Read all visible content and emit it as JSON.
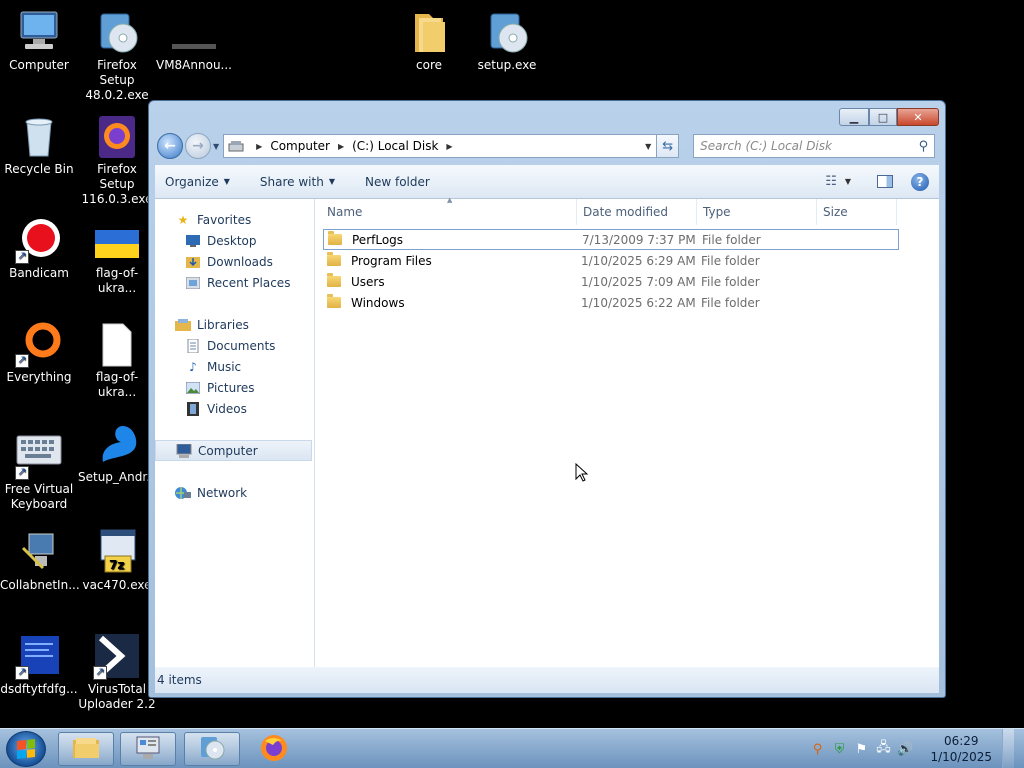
{
  "desktop": {
    "icons": {
      "computer": "Computer",
      "firefox48": "Firefox Setup 48.0.2.exe",
      "vm8": "VM8Annou...",
      "core": "core",
      "setup": "setup.exe",
      "recycle": "Recycle Bin",
      "firefox116": "Firefox Setup 116.0.3.exe",
      "bandicam": "Bandicam",
      "flag1": "flag-of-ukra...",
      "everything": "Everything",
      "flag2": "flag-of-ukra...",
      "keyboard": "Free Virtual Keyboard",
      "setup_andr": "Setup_Andr...",
      "collabnet": "CollabnetIn...",
      "vac": "vac470.exe",
      "dsdf": "dsdftytfdfg...",
      "virustotal": "VirusTotal Uploader 2.2"
    }
  },
  "window": {
    "address": {
      "crumbs": [
        "Computer",
        "(C:) Local Disk"
      ]
    },
    "search_placeholder": "Search (C:) Local Disk",
    "toolbar": {
      "organize": "Organize",
      "share_with": "Share with",
      "new_folder": "New folder"
    },
    "nav_pane": {
      "favorites": "Favorites",
      "desktop": "Desktop",
      "downloads": "Downloads",
      "recent": "Recent Places",
      "libraries": "Libraries",
      "documents": "Documents",
      "music": "Music",
      "pictures": "Pictures",
      "videos": "Videos",
      "computer": "Computer",
      "network": "Network"
    },
    "columns": {
      "name": "Name",
      "date": "Date modified",
      "type": "Type",
      "size": "Size"
    },
    "files": [
      {
        "name": "PerfLogs",
        "date": "7/13/2009 7:37 PM",
        "type": "File folder"
      },
      {
        "name": "Program Files",
        "date": "1/10/2025 6:29 AM",
        "type": "File folder"
      },
      {
        "name": "Users",
        "date": "1/10/2025 7:09 AM",
        "type": "File folder"
      },
      {
        "name": "Windows",
        "date": "1/10/2025 6:22 AM",
        "type": "File folder"
      }
    ],
    "status": "4 items"
  },
  "taskbar": {
    "clock_time": "06:29",
    "clock_date": "1/10/2025"
  }
}
